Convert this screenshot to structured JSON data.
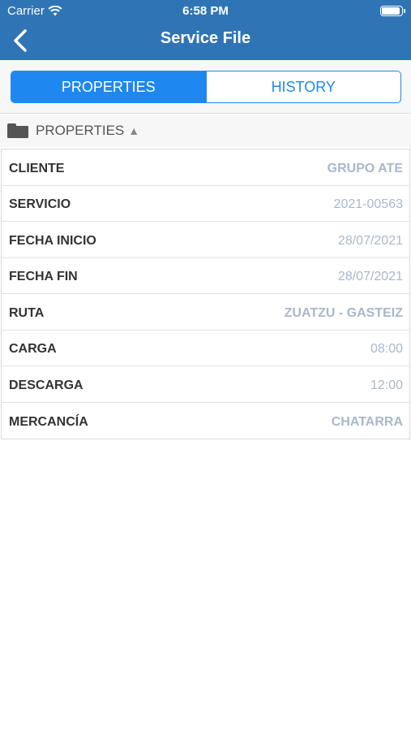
{
  "status_bar": {
    "carrier": "Carrier",
    "time": "6:58 PM"
  },
  "nav": {
    "title": "Service File"
  },
  "tabs": [
    {
      "label": "PROPERTIES",
      "active": true
    },
    {
      "label": "HISTORY",
      "active": false
    }
  ],
  "section": {
    "title": "PROPERTIES",
    "toggle_glyph": "▲"
  },
  "properties": [
    {
      "label": "CLIENTE",
      "value": "GRUPO ATE"
    },
    {
      "label": "SERVICIO",
      "value": "2021-00563"
    },
    {
      "label": "FECHA INICIO",
      "value": "28/07/2021"
    },
    {
      "label": "FECHA FIN",
      "value": "28/07/2021"
    },
    {
      "label": "RUTA",
      "value": "ZUATZU - GASTEIZ"
    },
    {
      "label": "CARGA",
      "value": "08:00"
    },
    {
      "label": "DESCARGA",
      "value": "12:00"
    },
    {
      "label": "MERCANCÍA",
      "value": "CHATARRA"
    }
  ],
  "icons": {
    "wifi": "wifi-icon",
    "battery": "battery-icon",
    "back": "chevron-left-icon",
    "folder": "folder-icon"
  },
  "colors": {
    "nav_bar": "#2f75b5",
    "accent": "#1e88f0",
    "value_text": "#a9b8cc"
  }
}
